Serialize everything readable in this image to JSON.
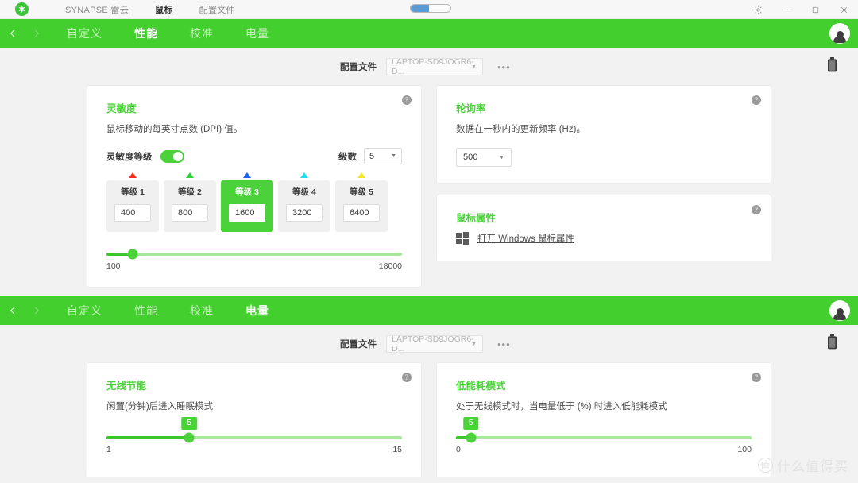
{
  "titlebar": {
    "logo_icon": "razer-logo-icon",
    "menu": [
      {
        "label": "SYNAPSE 雷云",
        "active": false
      },
      {
        "label": "鼠标",
        "active": true
      },
      {
        "label": "配置文件",
        "active": false
      }
    ],
    "progress_percent": 45,
    "controls": [
      {
        "name": "settings-gear-icon",
        "glyph": "gear"
      },
      {
        "name": "minimize-icon",
        "glyph": "minimize"
      },
      {
        "name": "maximize-icon",
        "glyph": "maximize"
      },
      {
        "name": "close-icon",
        "glyph": "close"
      }
    ]
  },
  "panel_top": {
    "nav": {
      "back_icon": "chevron-left-icon",
      "forward_icon": "chevron-right-icon",
      "tabs": [
        {
          "label": "自定义",
          "active": false
        },
        {
          "label": "性能",
          "active": true
        },
        {
          "label": "校准",
          "active": false
        },
        {
          "label": "电量",
          "active": false
        }
      ],
      "avatar": "user-avatar"
    },
    "profile": {
      "label": "配置文件",
      "value": "LAPTOP-SD9JOGR6-D...",
      "more_label": "•••",
      "battery_icon": "battery-icon"
    },
    "sensitivity_card": {
      "title": "灵敏度",
      "description": "鼠标移动的每英寸点数 (DPI) 值。",
      "toggle_label": "灵敏度等级",
      "toggle_on": true,
      "stage_count_label": "级数",
      "stage_count_value": "5",
      "stages": [
        {
          "name": "等级 1",
          "value": "400",
          "color": "#ff2b1a",
          "selected": false
        },
        {
          "name": "等级 2",
          "value": "800",
          "color": "#2ed437",
          "selected": false
        },
        {
          "name": "等级 3",
          "value": "1600",
          "color": "#1d63f0",
          "selected": true
        },
        {
          "name": "等级 4",
          "value": "3200",
          "color": "#24d9f2",
          "selected": false
        },
        {
          "name": "等级 5",
          "value": "6400",
          "color": "#f5e52b",
          "selected": false
        }
      ],
      "slider": {
        "min_label": "100",
        "max_label": "18000",
        "percent": 9
      }
    },
    "polling_card": {
      "title": "轮询率",
      "description": "数据在一秒内的更新频率 (Hz)。",
      "value": "500"
    },
    "mouse_props_card": {
      "title": "鼠标属性",
      "windows_icon": "windows-logo-icon",
      "link_label": "打开 Windows 鼠标属性"
    }
  },
  "panel_bottom": {
    "nav": {
      "back_icon": "chevron-left-icon",
      "forward_icon": "chevron-right-icon",
      "tabs": [
        {
          "label": "自定义",
          "active": false
        },
        {
          "label": "性能",
          "active": false
        },
        {
          "label": "校准",
          "active": false
        },
        {
          "label": "电量",
          "active": true
        }
      ],
      "avatar": "user-avatar"
    },
    "profile": {
      "label": "配置文件",
      "value": "LAPTOP-SD9JOGR6-D...",
      "more_label": "•••",
      "battery_icon": "battery-icon"
    },
    "wireless_card": {
      "title": "无线节能",
      "description": "闲置(分钟)后进入睡眠模式",
      "slider": {
        "value": "5",
        "min_label": "1",
        "max_label": "15",
        "percent": 28
      }
    },
    "lowpower_card": {
      "title": "低能耗模式",
      "description": "处于无线模式时，当电量低于 (%) 时进入低能耗模式",
      "slider": {
        "value": "5",
        "min_label": "0",
        "max_label": "100",
        "percent": 5
      }
    }
  },
  "watermark": {
    "mark": "值",
    "text": "什么值得买"
  },
  "colors": {
    "brand_green": "#43cf2e",
    "accent_green": "#4bd23b",
    "track_light": "#a8e89d",
    "page_bg": "#f2f2f2"
  }
}
